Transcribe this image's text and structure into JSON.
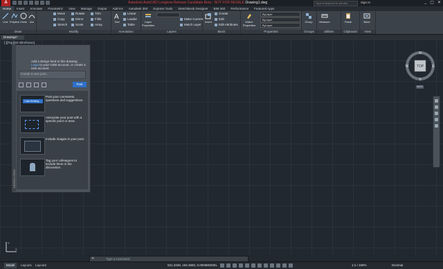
{
  "titlebar": {
    "app_letter": "A",
    "title_prefix": "Autodesk AutoCAD Longbow Release Candidate Beta - NOT FOR RESALE",
    "file_name": "Drawing1.dwg",
    "search_placeholder": "Type a keyword or phrase",
    "sign_in": "Sign In",
    "window_buttons": [
      "_",
      "▢",
      "✕"
    ]
  },
  "ribbon_tabs": [
    "Home",
    "Insert",
    "Annotate",
    "Parametric",
    "View",
    "Manage",
    "Output",
    "Add-ins",
    "Autodesk 360",
    "Express Tools",
    "SketchBook Designer",
    "BIM 360",
    "Performance",
    "Featured Apps"
  ],
  "ribbon": {
    "draw": {
      "title": "Draw",
      "line": "Line",
      "polyline": "Polyline",
      "circle": "Circle",
      "arc": "Arc"
    },
    "modify": {
      "title": "Modify",
      "move": "Move",
      "copy": "Copy",
      "stretch": "Stretch",
      "rotate": "Rotate",
      "mirror": "Mirror",
      "scale": "Scale",
      "trim": "Trim",
      "fillet": "Fillet",
      "array": "Array"
    },
    "annotation": {
      "title": "Annotation",
      "text": "Text",
      "linear": "Linear",
      "leader": "Leader",
      "table": "Table"
    },
    "layers": {
      "title": "Layers",
      "layer_properties": "Layer Properties",
      "make_current": "Make Current",
      "match_layer": "Match Layer"
    },
    "block": {
      "title": "Block",
      "insert": "Insert",
      "create": "Create",
      "edit": "Edit",
      "edit_attributes": "Edit Attributes"
    },
    "properties": {
      "title": "Properties",
      "match_properties": "Match Properties",
      "bylayer1": "ByLayer",
      "bylayer2": "ByLayer",
      "bylayer3": "ByLayer"
    },
    "groups": {
      "title": "Groups",
      "group": "Group"
    },
    "utilities": {
      "title": "Utilities",
      "measure": "Measure"
    },
    "clipboard": {
      "title": "Clipboard",
      "paste": "Paste"
    },
    "view": {
      "title": "View",
      "base": "Base"
    }
  },
  "file_tab": "Drawing1*",
  "viewport_label": "[-][Top][2D Wireframe]",
  "shared_views": {
    "prompt_line1": "Add a design feed to this drawing.",
    "prompt_link": "Login",
    "prompt_line2": "to your A360 account, or create a new account.",
    "input_placeholder": "Create a new post...",
    "post_button": "Post",
    "items": [
      {
        "thumb_label": "I was thinking...",
        "text": "Post your comments, questions and suggestions."
      },
      {
        "thumb_label": "",
        "text": "Associate your post with a specific point or area."
      },
      {
        "thumb_label": "",
        "text": "Include images in your post."
      },
      {
        "thumb_label": "",
        "text": "Tag your colleagues to include them in the discussion."
      }
    ],
    "vertical_label": "DESIGN FEED"
  },
  "viewcube": {
    "top": "TOP",
    "n": "N",
    "s": "S",
    "e": "E",
    "w": "W",
    "wcs": "WCS"
  },
  "ucs": {
    "x": "X",
    "y": "Y"
  },
  "command_line": {
    "close": "✕",
    "placeholder": "Type a command"
  },
  "layout_tabs": [
    "Model",
    "Layout1",
    "Layout2"
  ],
  "status": {
    "coords": "521.3349, 194.3693, 0.0000",
    "model": "MODEL",
    "annotation_scale": "1:1 / 100%",
    "units": "Decimal"
  }
}
